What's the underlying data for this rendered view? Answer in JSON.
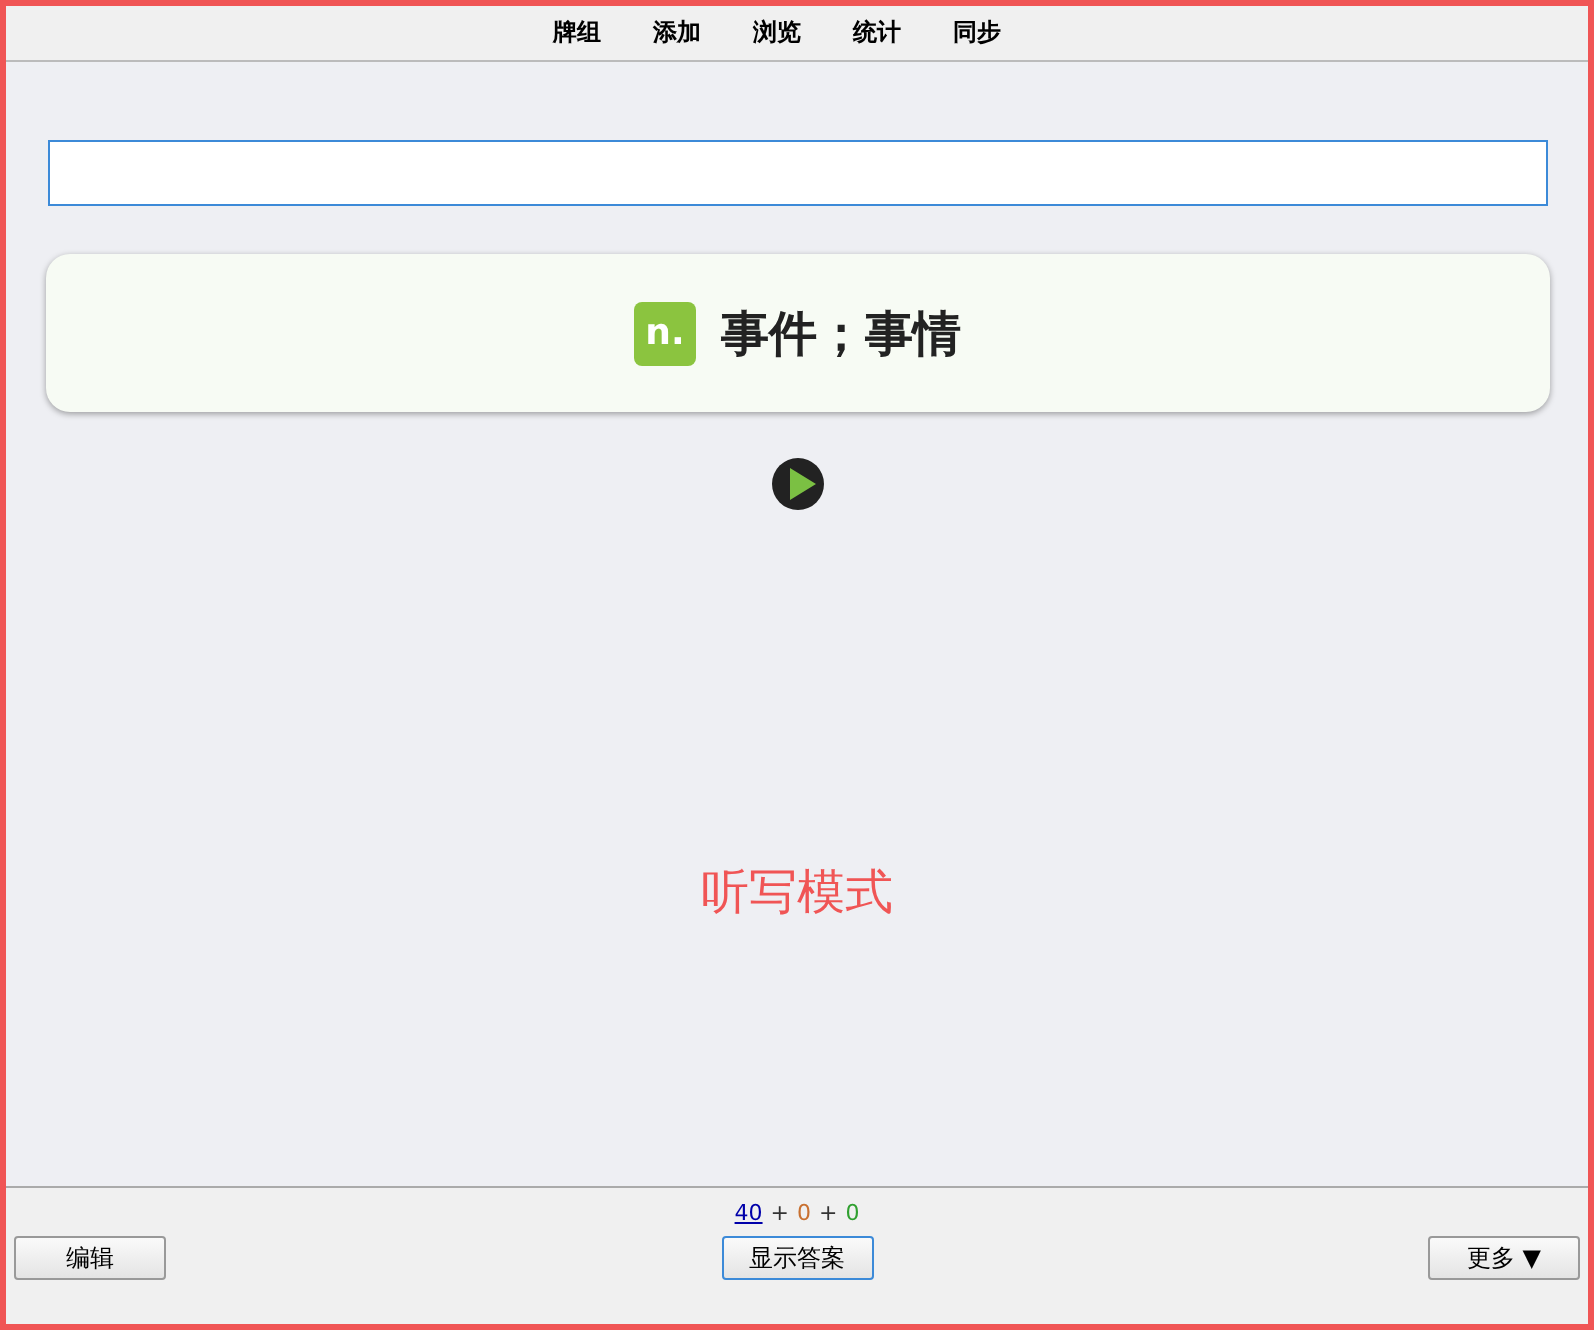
{
  "menu": [
    "牌组",
    "添加",
    "浏览",
    "统计",
    "同步"
  ],
  "card": {
    "part_of_speech": "n.",
    "meaning": "事件；事情"
  },
  "mode_label": "听写模式",
  "counts": [
    {
      "text": "40",
      "color": "#0000aa",
      "underlined": true
    },
    {
      "text": "+",
      "color": "#333333",
      "underlined": false
    },
    {
      "text": "0",
      "color": "#c87030",
      "underlined": false
    },
    {
      "text": "+",
      "color": "#333333",
      "underlined": false
    },
    {
      "text": "0",
      "color": "#30a030",
      "underlined": false
    }
  ],
  "buttons": {
    "edit": "编辑",
    "show_answer": "显示答案",
    "more": "更多 ▼"
  }
}
